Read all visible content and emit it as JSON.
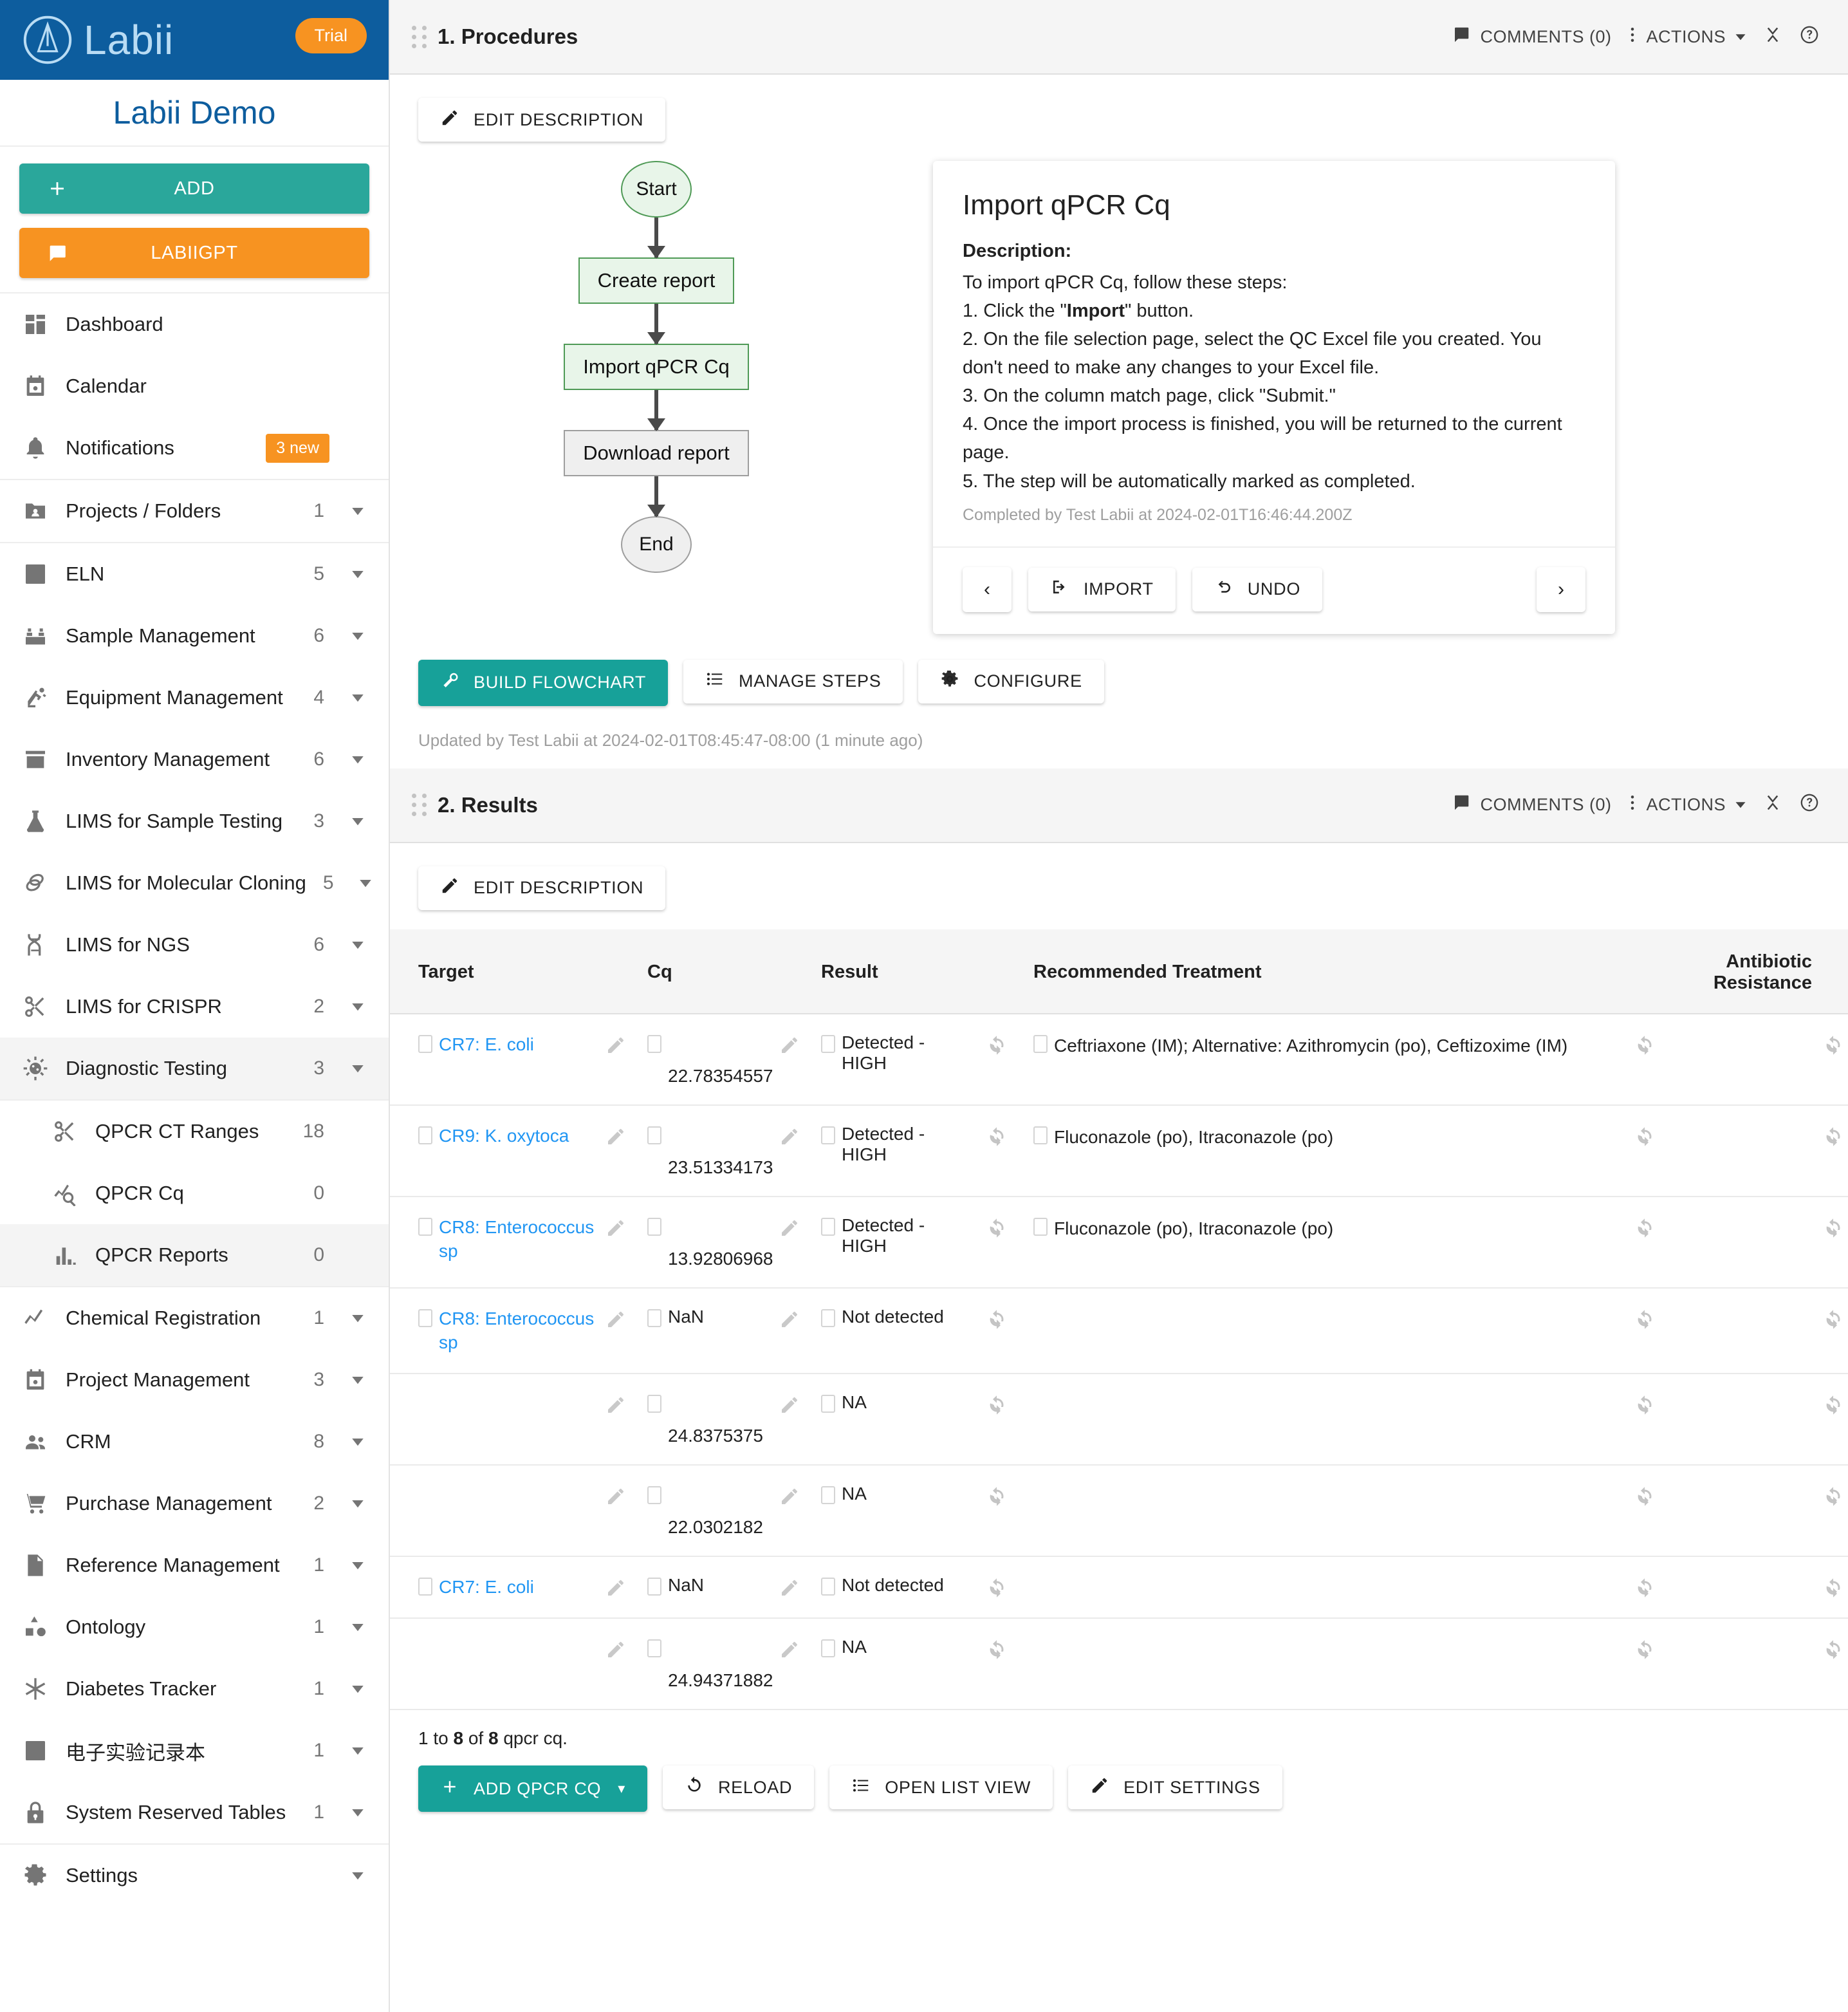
{
  "sidebar": {
    "brand_word": "Labii",
    "trial_badge": "Trial",
    "workspace_name": "Labii Demo",
    "add_label": "ADD",
    "gpt_label": "LABIIGPT",
    "groups": [
      {
        "items": [
          {
            "label": "Dashboard",
            "icon": "dashboard-icon",
            "count": "",
            "caret": false,
            "badge": ""
          },
          {
            "label": "Calendar",
            "icon": "calendar-icon",
            "count": "",
            "caret": false,
            "badge": ""
          },
          {
            "label": "Notifications",
            "icon": "bell-icon",
            "count": "",
            "caret": false,
            "badge": "3 new"
          }
        ]
      },
      {
        "items": [
          {
            "label": "Projects / Folders",
            "icon": "folder-user-icon",
            "count": "1",
            "caret": true,
            "badge": ""
          }
        ]
      },
      {
        "items": [
          {
            "label": "ELN",
            "icon": "notebook-icon",
            "count": "5",
            "caret": true,
            "badge": ""
          },
          {
            "label": "Sample Management",
            "icon": "samples-icon",
            "count": "6",
            "caret": true,
            "badge": ""
          },
          {
            "label": "Equipment Management",
            "icon": "robot-arm-icon",
            "count": "4",
            "caret": true,
            "badge": ""
          },
          {
            "label": "Inventory Management",
            "icon": "box-icon",
            "count": "6",
            "caret": true,
            "badge": ""
          },
          {
            "label": "LIMS for Sample Testing",
            "icon": "flask-icon",
            "count": "3",
            "caret": true,
            "badge": ""
          },
          {
            "label": "LIMS for Molecular Cloning",
            "icon": "plasmid-icon",
            "count": "5",
            "caret": true,
            "badge": ""
          },
          {
            "label": "LIMS for NGS",
            "icon": "dna-icon",
            "count": "6",
            "caret": true,
            "badge": ""
          },
          {
            "label": "LIMS for CRISPR",
            "icon": "scissors-icon",
            "count": "2",
            "caret": true,
            "badge": ""
          },
          {
            "label": "Diagnostic Testing",
            "icon": "virus-icon",
            "count": "3",
            "caret": true,
            "badge": "",
            "active": true
          }
        ]
      },
      {
        "sub": true,
        "items": [
          {
            "label": "QPCR CT Ranges",
            "icon": "scissors-icon",
            "count": "18",
            "caret": false,
            "badge": ""
          },
          {
            "label": "QPCR Cq",
            "icon": "chart-search-icon",
            "count": "0",
            "caret": false,
            "badge": ""
          },
          {
            "label": "QPCR Reports",
            "icon": "bar-chart-icon",
            "count": "0",
            "caret": false,
            "badge": "",
            "active": true
          }
        ]
      },
      {
        "items": [
          {
            "label": "Chemical Registration",
            "icon": "trend-line-icon",
            "count": "1",
            "caret": true,
            "badge": ""
          },
          {
            "label": "Project Management",
            "icon": "calendar-icon",
            "count": "3",
            "caret": true,
            "badge": ""
          },
          {
            "label": "CRM",
            "icon": "people-icon",
            "count": "8",
            "caret": true,
            "badge": ""
          },
          {
            "label": "Purchase Management",
            "icon": "cart-icon",
            "count": "2",
            "caret": true,
            "badge": ""
          },
          {
            "label": "Reference Management",
            "icon": "document-icon",
            "count": "1",
            "caret": true,
            "badge": ""
          },
          {
            "label": "Ontology",
            "icon": "shapes-icon",
            "count": "1",
            "caret": true,
            "badge": ""
          },
          {
            "label": "Diabetes Tracker",
            "icon": "asterisk-icon",
            "count": "1",
            "caret": true,
            "badge": ""
          },
          {
            "label": "电子实验记录本",
            "icon": "notebook-icon",
            "count": "1",
            "caret": true,
            "badge": ""
          },
          {
            "label": "System Reserved Tables",
            "icon": "lock-icon",
            "count": "1",
            "caret": true,
            "badge": ""
          }
        ]
      },
      {
        "items": [
          {
            "label": "Settings",
            "icon": "gear-icon",
            "count": "",
            "caret": true,
            "badge": ""
          }
        ]
      }
    ]
  },
  "procedures": {
    "title": "1. Procedures",
    "comments_label": "COMMENTS (0)",
    "actions_label": "ACTIONS",
    "edit_description_label": "EDIT DESCRIPTION",
    "flowchart": {
      "start": "Start",
      "nodes": [
        "Create report",
        "Import qPCR Cq",
        "Download report"
      ],
      "end": "End"
    },
    "step_card": {
      "title": "Import qPCR Cq",
      "description_label": "Description:",
      "intro": "To import qPCR Cq, follow these steps:",
      "steps_pre": [
        "1. Click the \"",
        "\" button."
      ],
      "bold_word": "Import",
      "steps": [
        "2. On the file selection page, select the QC Excel file you created. You don't need to make any changes to your Excel file.",
        "3. On the column match page, click \"Submit.\"",
        "4. Once the import process is finished, you will be returned to the current page.",
        "5. The step will be automatically marked as completed."
      ],
      "completed_meta": "Completed by Test Labii at 2024-02-01T16:46:44.200Z",
      "prev_label": "‹",
      "import_label": "IMPORT",
      "undo_label": "UNDO",
      "next_label": "›"
    },
    "build_flowchart_label": "BUILD FLOWCHART",
    "manage_steps_label": "MANAGE STEPS",
    "configure_label": "CONFIGURE",
    "updated_note": "Updated by Test Labii at 2024-02-01T08:45:47-08:00 (1 minute ago)"
  },
  "results": {
    "title": "2. Results",
    "comments_label": "COMMENTS (0)",
    "actions_label": "ACTIONS",
    "edit_description_label": "EDIT DESCRIPTION",
    "columns": [
      "Target",
      "Cq",
      "Result",
      "Recommended Treatment",
      "Antibiotic Resistance"
    ],
    "rows": [
      {
        "target": "CR7: E. coli",
        "cq": "22.78354557",
        "result_a": "Detected -",
        "result_b": "HIGH",
        "treatment": "Ceftriaxone (IM); Alternative: Azithromycin (po), Ceftizoxime (IM)"
      },
      {
        "target": "CR9: K. oxytoca",
        "cq": "23.51334173",
        "result_a": "Detected -",
        "result_b": "HIGH",
        "treatment": "Fluconazole (po), Itraconazole (po)"
      },
      {
        "target": "CR8: Enterococcus sp",
        "cq": "13.92806968",
        "result_a": "Detected -",
        "result_b": "HIGH",
        "treatment": "Fluconazole (po), Itraconazole (po)"
      },
      {
        "target": "CR8: Enterococcus sp",
        "cq": "NaN",
        "result_a": "Not detected",
        "result_b": "",
        "treatment": ""
      },
      {
        "target": "",
        "cq": "24.8375375",
        "result_a": "NA",
        "result_b": "",
        "treatment": ""
      },
      {
        "target": "",
        "cq": "22.0302182",
        "result_a": "NA",
        "result_b": "",
        "treatment": ""
      },
      {
        "target": "CR7: E. coli",
        "cq": "NaN",
        "result_a": "Not detected",
        "result_b": "",
        "treatment": ""
      },
      {
        "target": "",
        "cq": "24.94371882",
        "result_a": "NA",
        "result_b": "",
        "treatment": ""
      }
    ],
    "count_prefix": "1 to ",
    "count_shown": "8",
    "count_mid": " of ",
    "count_total": "8",
    "count_suffix": " qpcr cq.",
    "add_label": "ADD QPCR CQ",
    "reload_label": "RELOAD",
    "open_list_label": "OPEN LIST VIEW",
    "edit_settings_label": "EDIT SETTINGS"
  },
  "colors": {
    "brand_blue": "#0d5d9e",
    "teal": "#17a199",
    "orange": "#f79321",
    "link_blue": "#2196f3",
    "node_green_bg": "#e8f5e9",
    "node_green_border": "#4f9a56"
  }
}
